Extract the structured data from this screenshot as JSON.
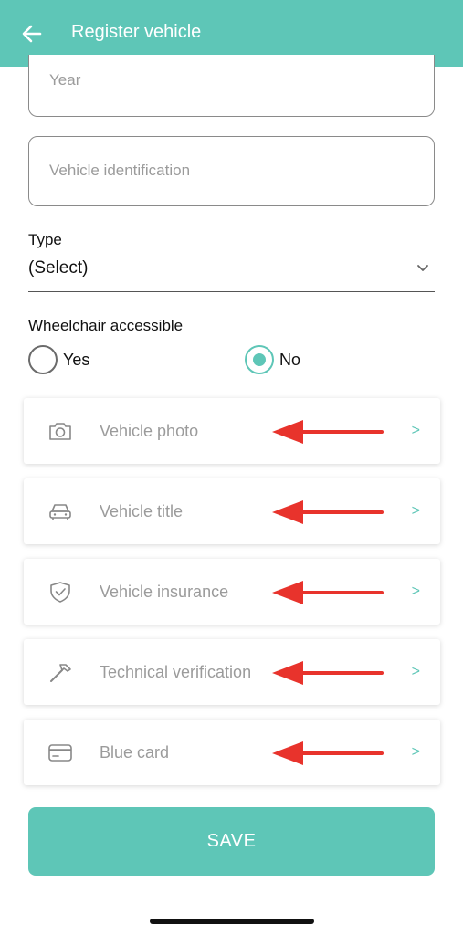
{
  "header": {
    "title": "Register vehicle",
    "back_icon": "arrow-left-icon",
    "background_color": "#5ec6b7"
  },
  "form": {
    "year_placeholder": "Year",
    "vin_placeholder": "Vehicle identification",
    "type_label": "Type",
    "type_value": "(Select)",
    "wheelchair_label": "Wheelchair accessible",
    "wheelchair_options": [
      {
        "label": "Yes",
        "selected": false
      },
      {
        "label": "No",
        "selected": true
      }
    ]
  },
  "documents": [
    {
      "label": "Vehicle photo",
      "icon": "camera-icon",
      "chevron": ">"
    },
    {
      "label": "Vehicle title",
      "icon": "car-icon",
      "chevron": ">"
    },
    {
      "label": "Vehicle insurance",
      "icon": "shield-check-icon",
      "chevron": ">"
    },
    {
      "label": "Technical verification",
      "icon": "hammer-icon",
      "chevron": ">"
    },
    {
      "label": "Blue card",
      "icon": "card-icon",
      "chevron": ">"
    }
  ],
  "annotation_arrow_color": "#e8332c",
  "save_label": "SAVE",
  "accent_color": "#5ec6b7"
}
